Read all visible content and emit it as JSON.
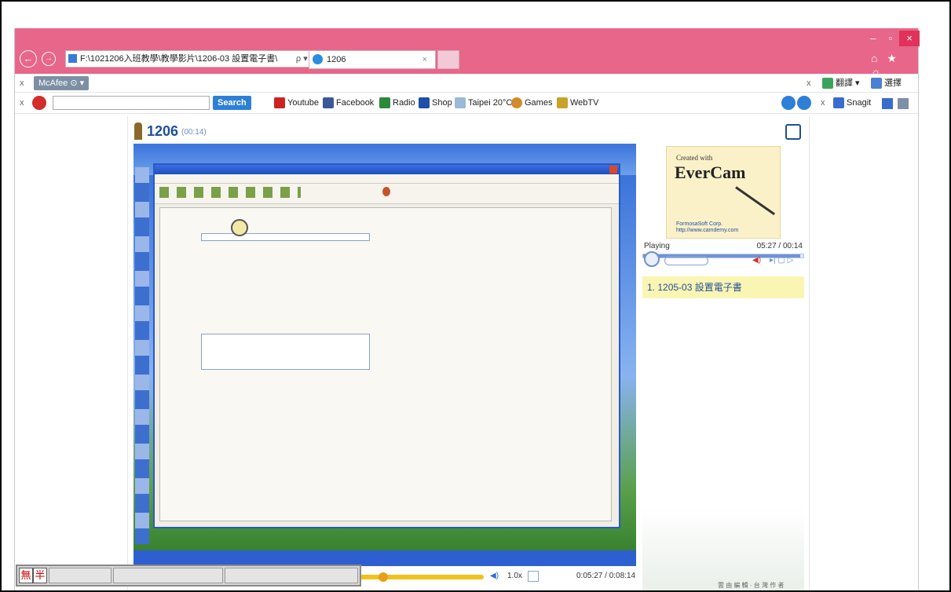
{
  "browser": {
    "address": "F:\\1021206入班教學\\教學影片\\1206-03 設置電子書\\",
    "address_icons": "ρ ▾ ↻",
    "tab_title": "1206",
    "tab_close": "×",
    "win_min": "–",
    "win_restore": "▫",
    "win_close": "×",
    "right_icons": "⌂ ★ ☼"
  },
  "toolbar1": {
    "close": "x",
    "mcafee": "McAfee",
    "right_close": "x",
    "item1": "翻譯",
    "item2": "選擇"
  },
  "toolbar2": {
    "close": "x",
    "search_placeholder": "",
    "search_button": "Search",
    "links": [
      "Youtube",
      "Facebook",
      "Radio",
      "Shop",
      "Taipei 20°C",
      "Games",
      "WebTV"
    ],
    "right_close": "x",
    "snagit": "Snagit"
  },
  "player": {
    "title": "1206",
    "duration": "(00:14)",
    "status": "Playing",
    "time": "05:27 / 00:14",
    "chapter": "1. 1205-03 設置電子書",
    "speed": "1.0x",
    "total_time": "0:05:27 / 0:08:14",
    "corner_text": "雲 由 編 輯 · 台 灣 作 者",
    "progress": 0.98
  },
  "evercam": {
    "created": "Created with",
    "brand": "EverCam",
    "company": "FormosaSoft Corp.",
    "url": "http://www.camdemy.com"
  },
  "ime": {
    "mode1": "無",
    "mode2": "半"
  },
  "colors": {
    "titlebar": "#e8668a",
    "accent": "#1e4f9a",
    "chapter_bg": "#fbf5b4"
  }
}
